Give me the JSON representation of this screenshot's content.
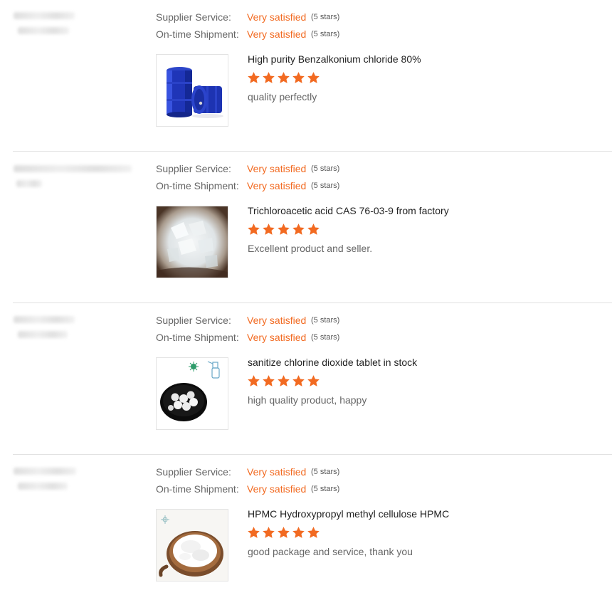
{
  "labels": {
    "supplier_service": "Supplier Service:",
    "ontime_shipment": "On-time Shipment:"
  },
  "colors": {
    "accent": "#f26a21",
    "star": "#f26a21"
  },
  "reviews": [
    {
      "supplier_service": {
        "value": "Very satisfied",
        "stars": "(5 stars)"
      },
      "ontime_shipment": {
        "value": "Very satisfied",
        "stars": "(5 stars)"
      },
      "product": {
        "title": "High purity Benzalkonium chloride 80%",
        "image_icon": "blue-barrels"
      },
      "rating": 5,
      "comment": "quality perfectly"
    },
    {
      "supplier_service": {
        "value": "Very satisfied",
        "stars": "(5 stars)"
      },
      "ontime_shipment": {
        "value": "Very satisfied",
        "stars": "(5 stars)"
      },
      "product": {
        "title": "Trichloroacetic acid CAS 76-03-9 from factory",
        "image_icon": "white-crystals-bag"
      },
      "rating": 5,
      "comment": "Excellent product and seller."
    },
    {
      "supplier_service": {
        "value": "Very satisfied",
        "stars": "(5 stars)"
      },
      "ontime_shipment": {
        "value": "Very satisfied",
        "stars": "(5 stars)"
      },
      "product": {
        "title": "sanitize chlorine dioxide tablet in stock",
        "image_icon": "tablets-in-bowl"
      },
      "rating": 5,
      "comment": "high quality product, happy"
    },
    {
      "supplier_service": {
        "value": "Very satisfied",
        "stars": "(5 stars)"
      },
      "ontime_shipment": {
        "value": "Very satisfied",
        "stars": "(5 stars)"
      },
      "product": {
        "title": "HPMC Hydroxypropyl methyl cellulose HPMC",
        "image_icon": "white-powder-wooden-bowl"
      },
      "rating": 5,
      "comment": "good package and service, thank you"
    }
  ]
}
